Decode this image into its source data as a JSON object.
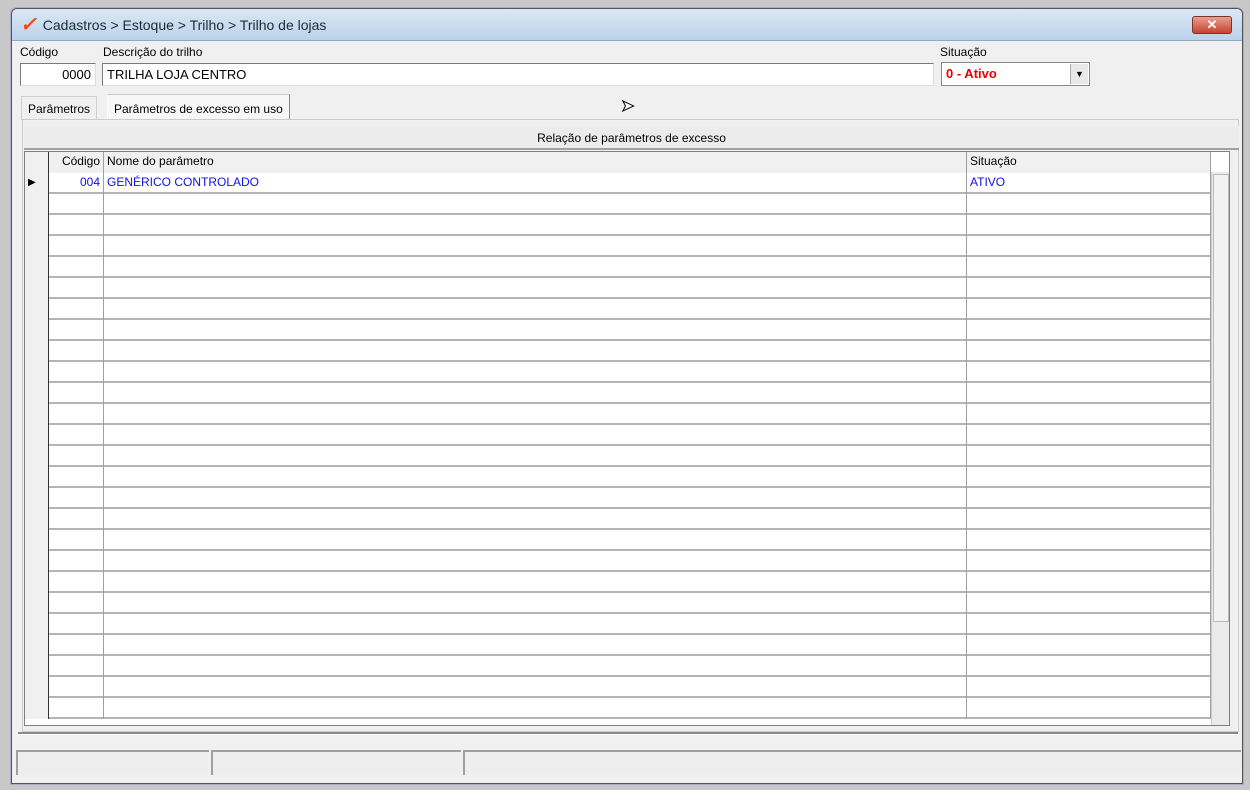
{
  "window": {
    "title": "Cadastros > Estoque > Trilho > Trilho de lojas",
    "close_label": "✕"
  },
  "form": {
    "codigo_label": "Código",
    "codigo_value": "0000",
    "descricao_label": "Descrição do trilho",
    "descricao_value": "TRILHA LOJA CENTRO",
    "situacao_label": "Situação",
    "situacao_value": "0 - Ativo"
  },
  "tabs": [
    {
      "label": "Parâmetros"
    },
    {
      "label": "Parâmetros de excesso em uso",
      "active": true
    }
  ],
  "grid": {
    "caption": "Relação de parâmetros de excesso",
    "columns": [
      "Código",
      "Nome do parâmetro",
      "Situação"
    ],
    "rows": [
      {
        "codigo": "004",
        "nome": "GENÉRICO CONTROLADO",
        "situacao": "ATIVO",
        "selected": true
      }
    ]
  }
}
